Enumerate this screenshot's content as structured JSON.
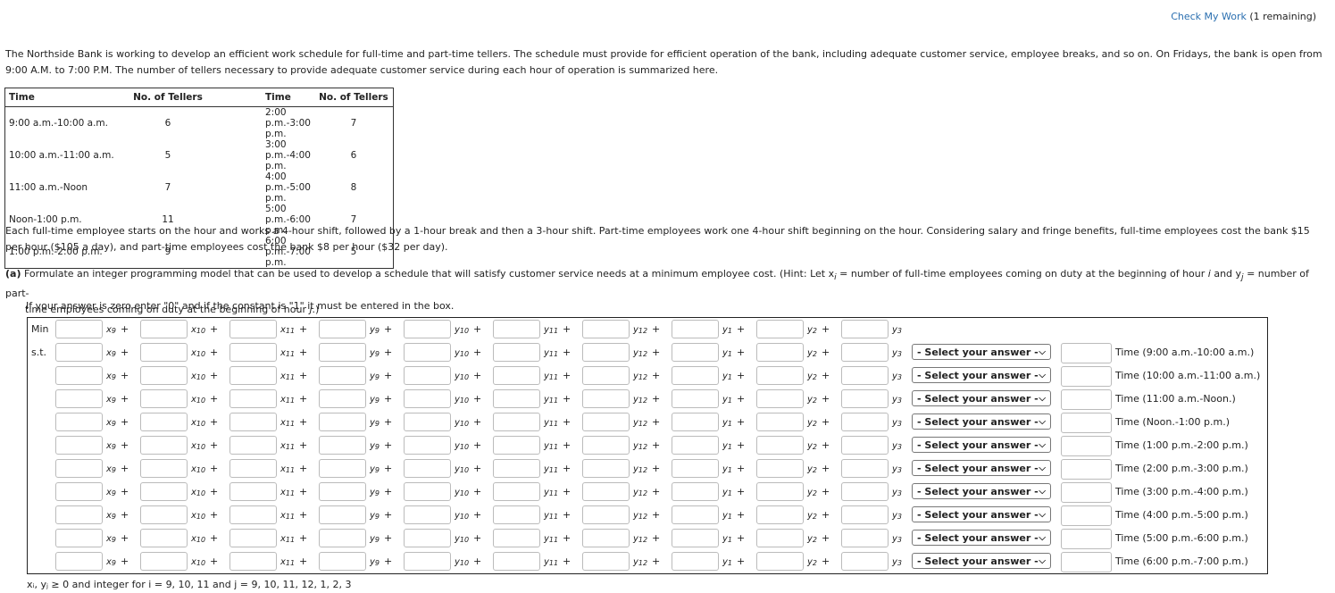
{
  "check": {
    "label": "Check My Work",
    "remaining": "(1 remaining)"
  },
  "intro": "The Northside Bank is working to develop an efficient work schedule for full-time and part-time tellers. The schedule must provide for efficient operation of the bank, including adequate customer service, employee breaks, and so on. On Fridays, the bank is open from 9:00 A.M. to 7:00 P.M. The number of tellers necessary to provide adequate customer service during each hour of operation is summarized here.",
  "table": {
    "headers": [
      "Time",
      "No. of Tellers",
      "Time",
      "No. of Tellers"
    ],
    "rows": [
      [
        "9:00 a.m.-10:00 a.m.",
        "6",
        "2:00 p.m.-3:00 p.m.",
        "7"
      ],
      [
        "10:00 a.m.-11:00 a.m.",
        "5",
        "3:00 p.m.-4:00 p.m.",
        "6"
      ],
      [
        "11:00 a.m.-Noon",
        "7",
        "4:00 p.m.-5:00 p.m.",
        "8"
      ],
      [
        "Noon-1:00 p.m.",
        "11",
        "5:00 p.m.-6:00 p.m.",
        "7"
      ],
      [
        "1:00 p.m.-2:00 p.m.",
        "9",
        "6:00 p.m.-7:00 p.m.",
        "5"
      ]
    ]
  },
  "para2": "Each full-time employee starts on the hour and works a 4-hour shift, followed by a 1-hour break and then a 3-hour shift. Part-time employees work one 4-hour shift beginning on the hour. Considering salary and fringe benefits, full-time employees cost the bank $15 per hour ($105 a day), and part-time employees cost the bank $8 per hour ($32 per day).",
  "partA": {
    "label": "(a)",
    "text1": "Formulate an integer programming model that can be used to develop a schedule that will satisfy customer service needs at a minimum employee cost. (Hint: Let x",
    "text1b": "i",
    "text1c": " = number of full-time employees coming on duty at the beginning of hour ",
    "text1d": "i",
    "text1e": " and y",
    "text1f": "j",
    "text1g": " = number of part-",
    "text2": "time employees coming on duty at the beginning of hour ",
    "text2b": "j",
    "text2c": ".)"
  },
  "hint": "If your answer is zero enter \"0\" and if the constant is \"1\" it must be entered in the box.",
  "model": {
    "min_label": "Min",
    "st_label": "s.t.",
    "plus": "+",
    "variables": [
      [
        "x",
        "9"
      ],
      [
        "x",
        "10"
      ],
      [
        "x",
        "11"
      ],
      [
        "y",
        "9"
      ],
      [
        "y",
        "10"
      ],
      [
        "y",
        "11"
      ],
      [
        "y",
        "12"
      ],
      [
        "y",
        "1"
      ],
      [
        "y",
        "2"
      ],
      [
        "y",
        "3"
      ]
    ],
    "select_placeholder": "- Select your answer -",
    "constraints": [
      "Time (9:00 a.m.-10:00 a.m.)",
      "Time (10:00 a.m.-11:00 a.m.)",
      "Time (11:00 a.m.-Noon.)",
      "Time (Noon.-1:00 p.m.)",
      "Time (1:00 p.m.-2:00 p.m.)",
      "Time (2:00 p.m.-3:00 p.m.)",
      "Time (3:00 p.m.-4:00 p.m.)",
      "Time (4:00 p.m.-5:00 p.m.)",
      "Time (5:00 p.m.-6:00 p.m.)",
      "Time (6:00 p.m.-7:00 p.m.)"
    ]
  },
  "footer": "xᵢ, yⱼ ≥ 0 and integer for i = 9, 10, 11 and j = 9, 10, 11, 12, 1, 2, 3"
}
